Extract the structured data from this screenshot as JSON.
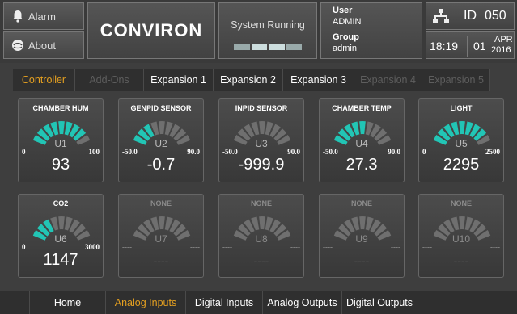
{
  "header": {
    "alarm_label": "Alarm",
    "about_label": "About",
    "brand": "CONVIRON",
    "status_text": "System Running",
    "user_label": "User",
    "user_value": "ADMIN",
    "group_label": "Group",
    "group_value": "admin",
    "id_label": "ID",
    "id_value": "050",
    "time": "18:19",
    "day": "01",
    "month": "APR",
    "year": "2016"
  },
  "tabs": [
    {
      "label": "Controller",
      "state": "active"
    },
    {
      "label": "Add-Ons",
      "state": "disabled"
    },
    {
      "label": "Expansion 1",
      "state": "normal"
    },
    {
      "label": "Expansion 2",
      "state": "normal"
    },
    {
      "label": "Expansion 3",
      "state": "normal"
    },
    {
      "label": "Expansion 4",
      "state": "disabled"
    },
    {
      "label": "Expansion 5",
      "state": "disabled"
    }
  ],
  "gauges": [
    {
      "name": "CHAMBER HUM",
      "unit": "U1",
      "min": "0",
      "max": "100",
      "value": "93",
      "active": true,
      "lit_segments": 8
    },
    {
      "name": "GENPID SENSOR",
      "unit": "U2",
      "min": "-50.0",
      "max": "90.0",
      "value": "-0.7",
      "active": true,
      "lit_segments": 3
    },
    {
      "name": "INPID SENSOR",
      "unit": "U3",
      "min": "-50.0",
      "max": "90.0",
      "value": "-999.9",
      "active": true,
      "lit_segments": 0
    },
    {
      "name": "CHAMBER TEMP",
      "unit": "U4",
      "min": "-50.0",
      "max": "90.0",
      "value": "27.3",
      "active": true,
      "lit_segments": 5
    },
    {
      "name": "LIGHT",
      "unit": "U5",
      "min": "0",
      "max": "2500",
      "value": "2295",
      "active": true,
      "lit_segments": 8
    },
    {
      "name": "CO2",
      "unit": "U6",
      "min": "0",
      "max": "3000",
      "value": "1147",
      "active": true,
      "lit_segments": 3
    },
    {
      "name": "NONE",
      "unit": "U7",
      "min": "----",
      "max": "----",
      "value": "----",
      "active": false,
      "lit_segments": 0
    },
    {
      "name": "NONE",
      "unit": "U8",
      "min": "----",
      "max": "----",
      "value": "----",
      "active": false,
      "lit_segments": 0
    },
    {
      "name": "NONE",
      "unit": "U9",
      "min": "----",
      "max": "----",
      "value": "----",
      "active": false,
      "lit_segments": 0
    },
    {
      "name": "NONE",
      "unit": "U10",
      "min": "----",
      "max": "----",
      "value": "----",
      "active": false,
      "lit_segments": 0
    }
  ],
  "bottom_nav": [
    {
      "label": "Home",
      "state": "normal"
    },
    {
      "label": "Analog Inputs",
      "state": "active"
    },
    {
      "label": "Digital Inputs",
      "state": "normal"
    },
    {
      "label": "Analog Outputs",
      "state": "normal"
    },
    {
      "label": "Digital Outputs",
      "state": "normal"
    }
  ],
  "colors": {
    "accent": "#e5a020",
    "gauge_lit": "#22c5b5",
    "gauge_unlit": "#6f6f6f",
    "background": "#3e3e3e"
  }
}
